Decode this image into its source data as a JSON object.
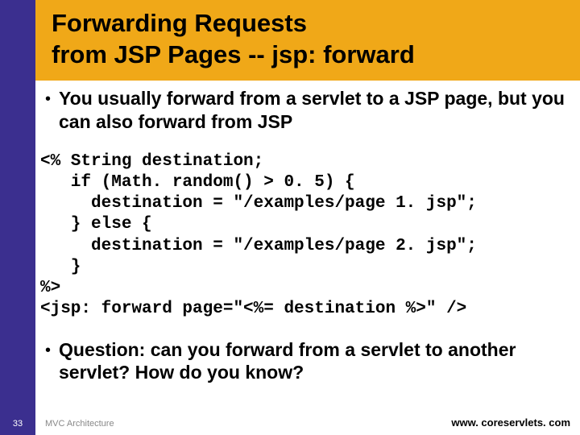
{
  "title_line1": "Forwarding Requests",
  "title_line2": "from JSP Pages -- jsp: forward",
  "bullet1": "You usually forward from a servlet to a JSP page, but you can also forward from JSP",
  "code": "<% String destination;\n   if (Math. random() > 0. 5) {\n     destination = \"/examples/page 1. jsp\";\n   } else {\n     destination = \"/examples/page 2. jsp\";\n   }\n%>\n<jsp: forward page=\"<%= destination %>\" />",
  "bullet2": "Question: can you forward from a servlet to another servlet? How do you know?",
  "page_number": "33",
  "footer_left": "MVC Architecture",
  "footer_right": "www. coreservlets. com"
}
